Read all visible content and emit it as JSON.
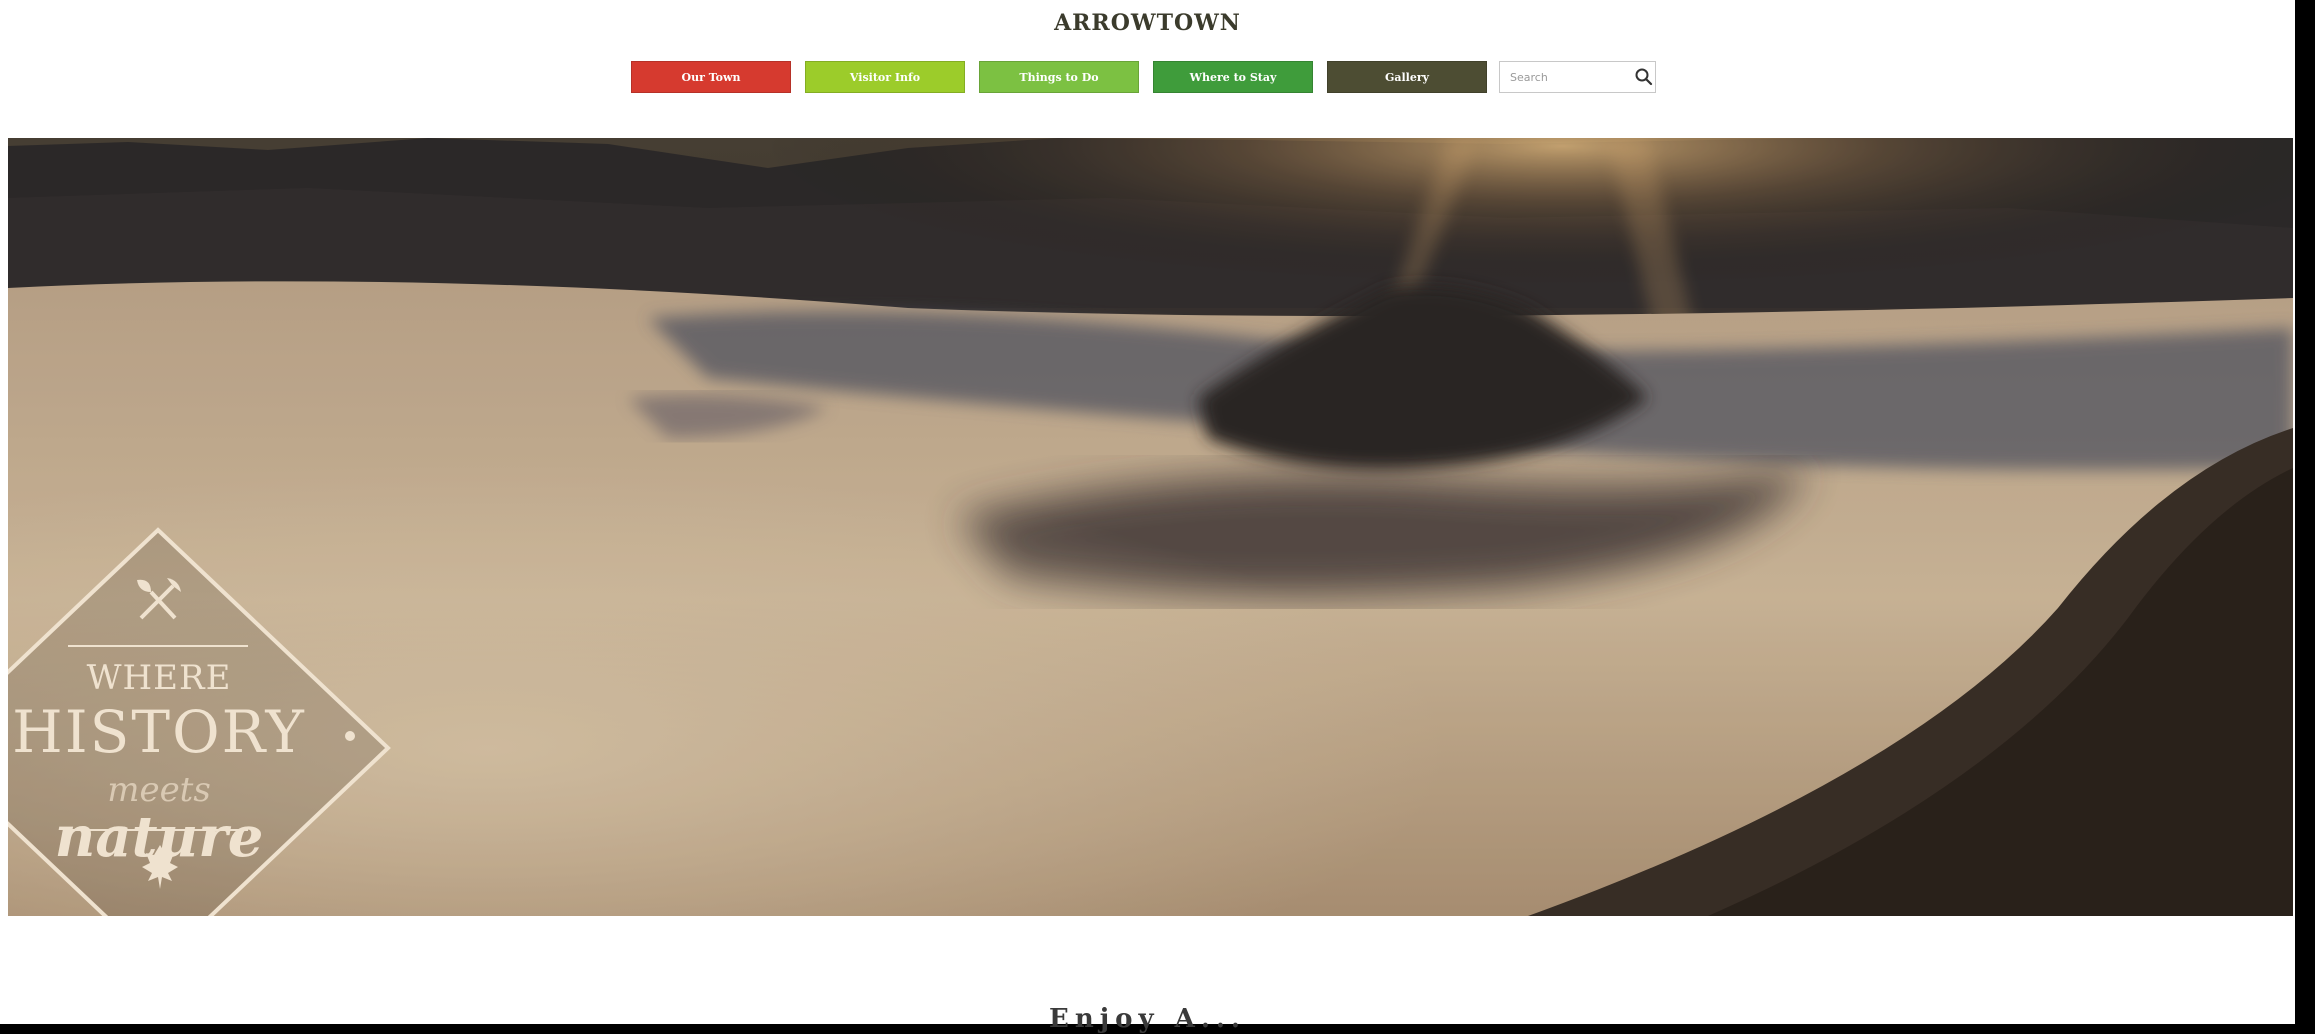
{
  "site": {
    "title": "ARROWTOWN"
  },
  "nav": {
    "items": [
      {
        "label": "Our Town",
        "color": "#d63a2f"
      },
      {
        "label": "Visitor Info",
        "color": "#9ccc2a"
      },
      {
        "label": "Things to Do",
        "color": "#7cc142"
      },
      {
        "label": "Where to Stay",
        "color": "#3f9c3b"
      },
      {
        "label": "Gallery",
        "color": "#4d4d33"
      }
    ],
    "search": {
      "placeholder": "Search",
      "value": "",
      "icon": "search-icon"
    }
  },
  "hero": {
    "badge": {
      "line1": "WHERE",
      "line2": "HISTORY",
      "line3": "meets",
      "line4": "nature",
      "top_icon": "pickaxe-shovel-icon",
      "bottom_icon": "leaf-icon"
    }
  },
  "content": {
    "heading_partial": "Enjoy A..."
  },
  "colors": {
    "title": "#3b3b2c",
    "badge_text": "#efe2cf"
  }
}
